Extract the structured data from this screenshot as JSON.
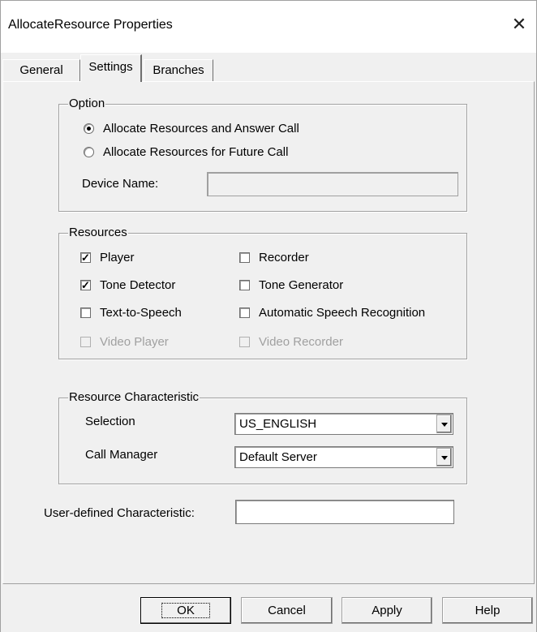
{
  "window": {
    "title": "AllocateResource Properties",
    "close_glyph": "✕"
  },
  "tabs": [
    {
      "label": "General",
      "active": false
    },
    {
      "label": "Settings",
      "active": true
    },
    {
      "label": "Branches",
      "active": false
    }
  ],
  "option": {
    "legend": "Option",
    "radios": [
      {
        "label": "Allocate Resources and Answer Call",
        "selected": true
      },
      {
        "label": "Allocate Resources for Future Call",
        "selected": false
      }
    ],
    "device_name_label": "Device Name:",
    "device_name_value": ""
  },
  "resources": {
    "legend": "Resources",
    "items": [
      {
        "label": "Player",
        "checked": true,
        "enabled": true
      },
      {
        "label": "Recorder",
        "checked": false,
        "enabled": true
      },
      {
        "label": "Tone Detector",
        "checked": true,
        "enabled": true
      },
      {
        "label": "Tone Generator",
        "checked": false,
        "enabled": true
      },
      {
        "label": "Text-to-Speech",
        "checked": false,
        "enabled": true
      },
      {
        "label": "Automatic Speech Recognition",
        "checked": false,
        "enabled": true
      },
      {
        "label": "Video Player",
        "checked": false,
        "enabled": false
      },
      {
        "label": "Video Recorder",
        "checked": false,
        "enabled": false
      }
    ]
  },
  "characteristic": {
    "legend": "Resource Characteristic",
    "selection_label": "Selection",
    "selection_value": "US_ENGLISH",
    "call_manager_label": "Call Manager",
    "call_manager_value": "Default Server"
  },
  "user_defined": {
    "label": "User-defined Characteristic:",
    "value": ""
  },
  "buttons": {
    "ok": "OK",
    "cancel": "Cancel",
    "apply": "Apply",
    "help": "Help"
  }
}
